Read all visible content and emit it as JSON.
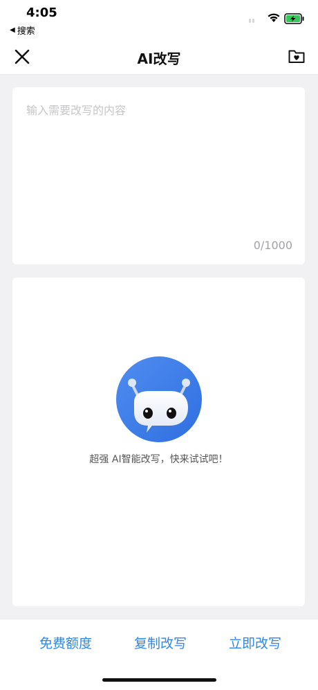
{
  "status_bar": {
    "time": "4:05",
    "back_label": "搜索",
    "back_arrow": "◀",
    "icons": [
      "wifi-icon",
      "battery-charging-icon"
    ]
  },
  "header": {
    "title": "AI改写",
    "close_icon": "close-icon",
    "folder_icon": "folder-heart-icon"
  },
  "input": {
    "placeholder": "输入需要改写的内容",
    "value": "",
    "counter": "0/1000"
  },
  "result": {
    "illustration": "robot-icon",
    "tip": "超强 AI智能改写，快来试试吧！"
  },
  "bottom_bar": {
    "free_quota": "免费额度",
    "copy": "复制改写",
    "rewrite_now": "立即改写"
  },
  "colors": {
    "accent": "#2f86e6",
    "background": "#f1f1f3",
    "card": "#ffffff",
    "placeholder": "#c6c6c9"
  }
}
